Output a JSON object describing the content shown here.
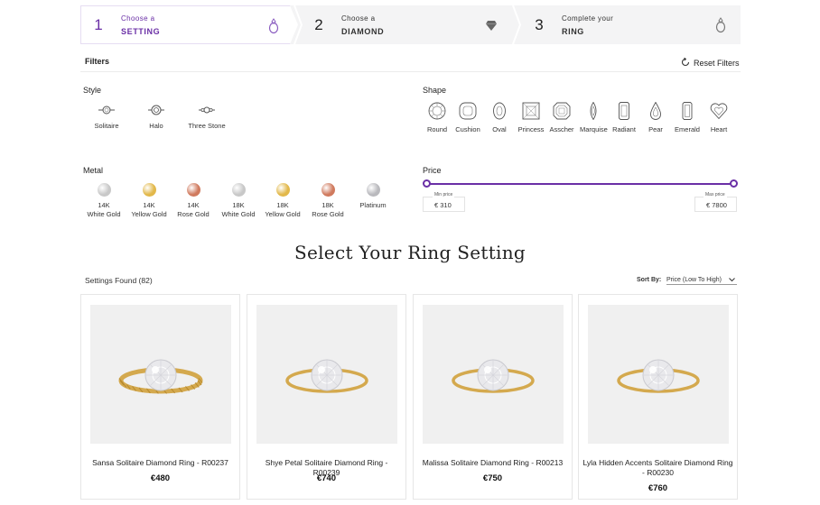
{
  "steps": [
    {
      "num": "1",
      "small": "Choose a",
      "big": "SETTING",
      "icon": "ring-icon"
    },
    {
      "num": "2",
      "small": "Choose a",
      "big": "DIAMOND",
      "icon": "diamond-icon"
    },
    {
      "num": "3",
      "small": "Complete your",
      "big": "RING",
      "icon": "ring-icon"
    }
  ],
  "filters": {
    "title": "Filters",
    "reset_label": "Reset Filters",
    "style": {
      "title": "Style",
      "options": [
        "Solitaire",
        "Halo",
        "Three Stone"
      ]
    },
    "shape": {
      "title": "Shape",
      "options": [
        "Round",
        "Cushion",
        "Oval",
        "Princess",
        "Asscher",
        "Marquise",
        "Radiant",
        "Pear",
        "Emerald",
        "Heart"
      ]
    },
    "metal": {
      "title": "Metal",
      "options": [
        {
          "line1": "14K",
          "line2": "White Gold",
          "color": "#c8c8c8"
        },
        {
          "line1": "14K",
          "line2": "Yellow Gold",
          "color": "#e2b84a"
        },
        {
          "line1": "14K",
          "line2": "Rose Gold",
          "color": "#d07a5e"
        },
        {
          "line1": "18K",
          "line2": "White Gold",
          "color": "#c8c8c8"
        },
        {
          "line1": "18K",
          "line2": "Yellow Gold",
          "color": "#e2b84a"
        },
        {
          "line1": "18K",
          "line2": "Rose Gold",
          "color": "#d07a5e"
        },
        {
          "line1": "Platinum",
          "line2": "",
          "color": "#b9b9bd"
        }
      ]
    },
    "price": {
      "title": "Price",
      "min_caption": "Min price",
      "max_caption": "Max price",
      "min_value": "€ 310",
      "max_value": "€ 7800"
    }
  },
  "heading": "Select Your Ring Setting",
  "results": {
    "found_label": "Settings Found (82)",
    "sort_label": "Sort By:",
    "sort_value": "Price (Low To High)"
  },
  "products": [
    {
      "name": "Sansa Solitaire Diamond Ring - R00237",
      "price": "€480",
      "band": "twisted"
    },
    {
      "name": "Shye Petal Solitaire Diamond Ring - R00239",
      "price": "€740",
      "band": "plain"
    },
    {
      "name": "Malissa Solitaire Diamond Ring - R00213",
      "price": "€750",
      "band": "plain"
    },
    {
      "name": "Lyla Hidden Accents Solitaire Diamond Ring - R00230",
      "price": "€760",
      "band": "plain"
    }
  ],
  "colors": {
    "accent": "#6a2fa6",
    "gold": "#d4a94e"
  }
}
